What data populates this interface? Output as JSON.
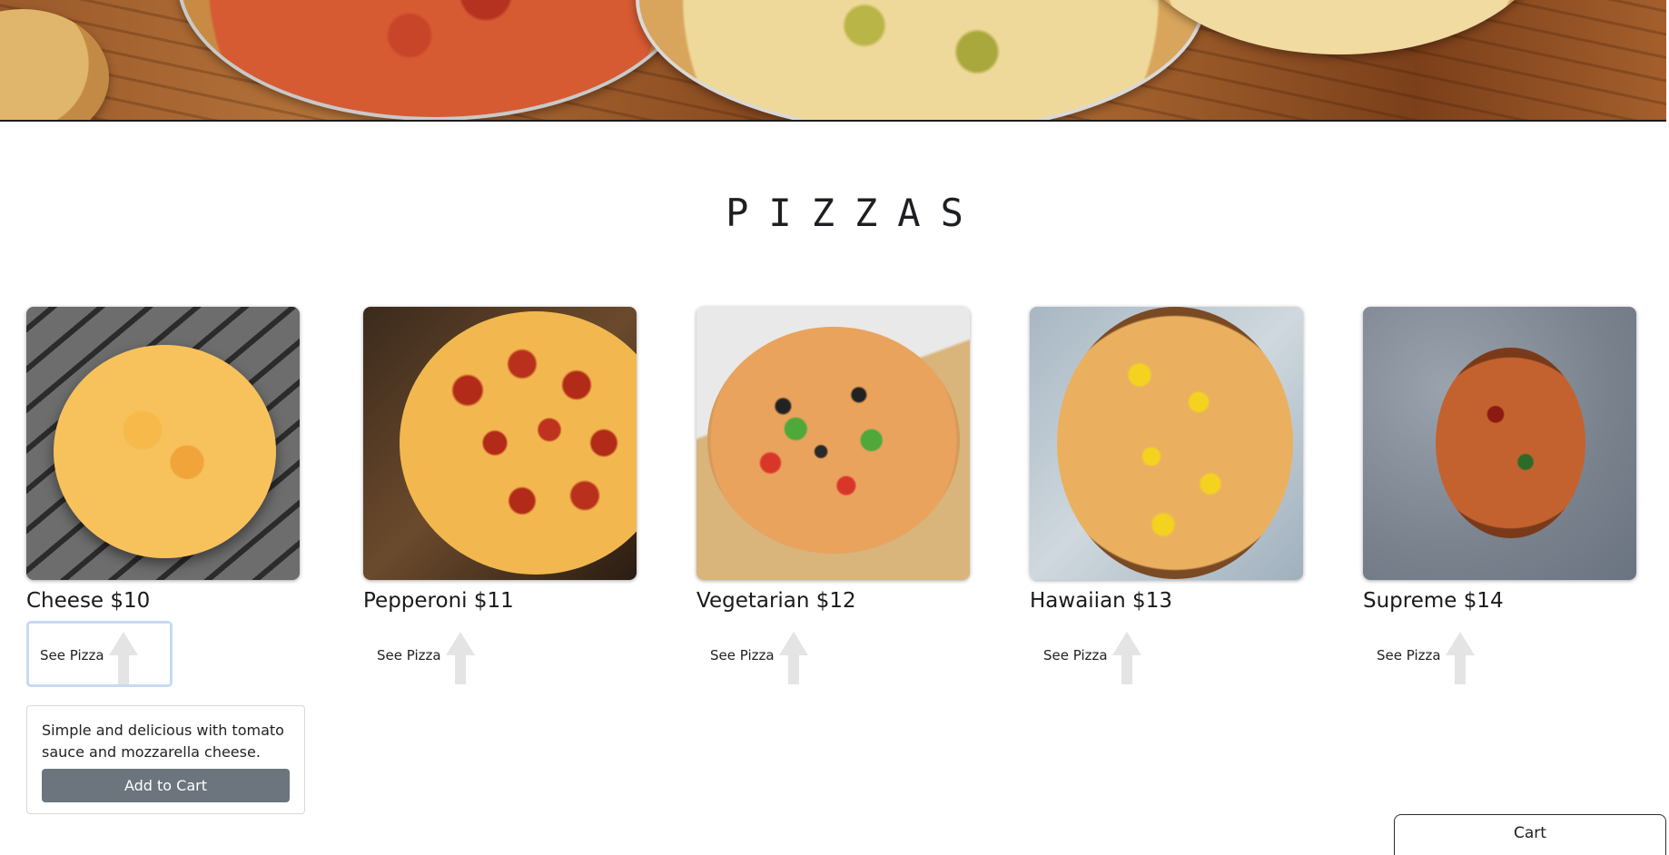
{
  "section": {
    "title": "PIZZAS"
  },
  "pizzas": [
    {
      "name": "Cheese $10",
      "see_label": "See Pizza"
    },
    {
      "name": "Pepperoni $11",
      "see_label": "See Pizza"
    },
    {
      "name": "Vegetarian $12",
      "see_label": "See Pizza"
    },
    {
      "name": "Hawaiian $13",
      "see_label": "See Pizza"
    },
    {
      "name": "Supreme $14",
      "see_label": "See Pizza"
    }
  ],
  "details": {
    "description": "Simple and delicious with tomato sauce and mozzarella cheese.",
    "add_to_cart_label": "Add to Cart"
  },
  "cart": {
    "label": "Cart"
  },
  "colors": {
    "add_button": "#6c757d",
    "focus_ring": "#c7daf3"
  },
  "icons": {
    "see_pizza_arrow": "arrow-up-icon"
  }
}
